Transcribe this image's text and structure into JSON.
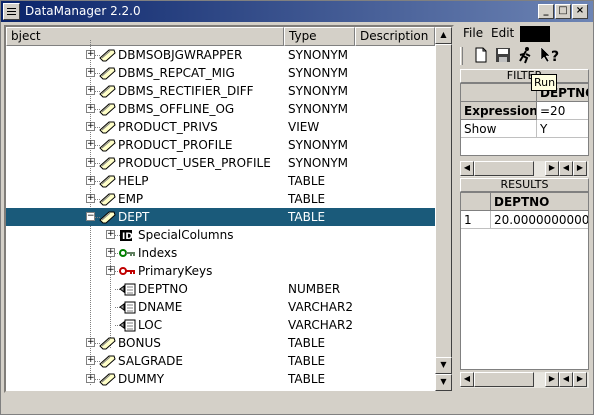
{
  "window": {
    "title": "DataManager 2.2.0"
  },
  "tree": {
    "columns": {
      "object": "bject",
      "type": "Type",
      "description": "Description"
    },
    "rows": [
      {
        "name": "DBMSOBJGWRAPPER",
        "type": "SYNONYM"
      },
      {
        "name": "DBMS_REPCAT_MIG",
        "type": "SYNONYM"
      },
      {
        "name": "DBMS_RECTIFIER_DIFF",
        "type": "SYNONYM"
      },
      {
        "name": "DBMS_OFFLINE_OG",
        "type": "SYNONYM"
      },
      {
        "name": "PRODUCT_PRIVS",
        "type": "VIEW"
      },
      {
        "name": "PRODUCT_PROFILE",
        "type": "SYNONYM"
      },
      {
        "name": "PRODUCT_USER_PROFILE",
        "type": "SYNONYM"
      },
      {
        "name": "HELP",
        "type": "TABLE"
      },
      {
        "name": "EMP",
        "type": "TABLE"
      },
      {
        "name": "DEPT",
        "type": "TABLE"
      },
      {
        "name": "SpecialColumns",
        "type": ""
      },
      {
        "name": "Indexs",
        "type": ""
      },
      {
        "name": "PrimaryKeys",
        "type": ""
      },
      {
        "name": "DEPTNO",
        "type": "NUMBER"
      },
      {
        "name": "DNAME",
        "type": "VARCHAR2"
      },
      {
        "name": "LOC",
        "type": "VARCHAR2"
      },
      {
        "name": "BONUS",
        "type": "TABLE"
      },
      {
        "name": "SALGRADE",
        "type": "TABLE"
      },
      {
        "name": "DUMMY",
        "type": "TABLE"
      }
    ]
  },
  "menu": {
    "file": "File",
    "edit": "Edit"
  },
  "toolbar": {
    "tooltip": "Run"
  },
  "filter": {
    "header": "FILTER",
    "column": "DEPTNO",
    "rows": [
      {
        "label": "Expression",
        "value": "=20"
      },
      {
        "label": "Show",
        "value": "Y"
      }
    ]
  },
  "results": {
    "header": "RESULTS",
    "column": "DEPTNO",
    "rows": [
      {
        "num": "1",
        "value": "20.0000000000"
      }
    ]
  },
  "colors": {
    "selection": "#1a5a7a",
    "title_bar": "#0a246a"
  }
}
